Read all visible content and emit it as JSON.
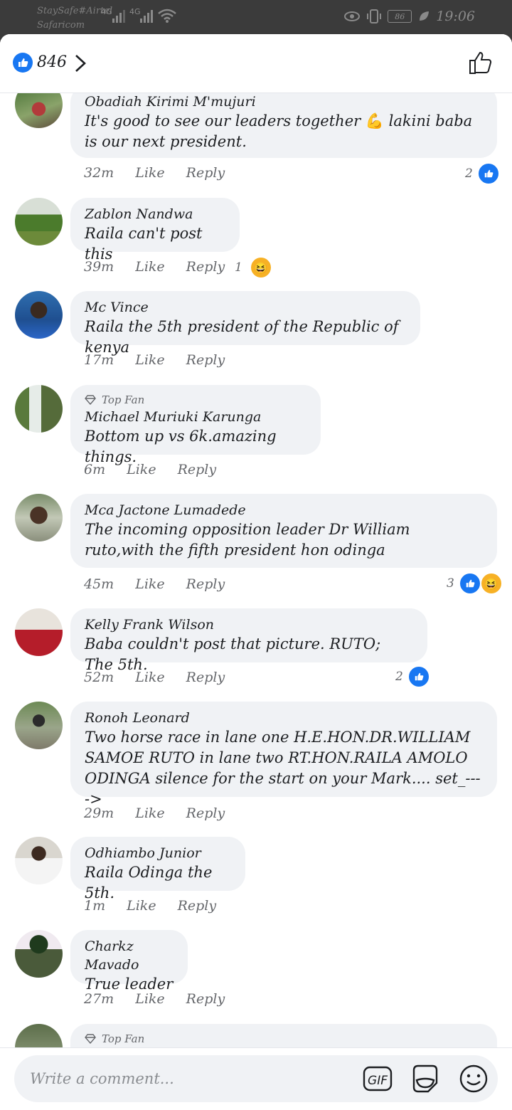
{
  "status_bar": {
    "carrier1": "StaySafe#Airtel",
    "carrier2": "Safaricom",
    "net1": "4G",
    "net2": "4G",
    "battery": "86",
    "time": "19:06"
  },
  "header": {
    "like_count": "846"
  },
  "comments": [
    {
      "author": "Obadiah Kirimi M'mujuri",
      "text_before": "It's good to see our leaders together ",
      "emoji": "💪",
      "text_after": " lakini  baba is our next president.",
      "time": "32m",
      "like": "Like",
      "reply": "Reply",
      "reaction_count": "2"
    },
    {
      "author": "Zablon Nandwa",
      "text": "Raila can't post this",
      "time": "39m",
      "like": "Like",
      "reply": "Reply",
      "reaction_count": "1"
    },
    {
      "author": "Mc Vince",
      "text": "Raila the 5th president of the Republic of kenya",
      "time": "17m",
      "like": "Like",
      "reply": "Reply"
    },
    {
      "badge": "Top Fan",
      "author": "Michael Muriuki Karunga",
      "text": "Bottom up vs 6k.amazing things.",
      "time": "6m",
      "like": "Like",
      "reply": "Reply"
    },
    {
      "author": "Mca Jactone Lumadede",
      "text": "The incoming opposition leader Dr William ruto,with the fifth president hon odinga",
      "time": "45m",
      "like": "Like",
      "reply": "Reply",
      "reaction_count": "3"
    },
    {
      "author": "Kelly Frank Wilson",
      "text": "Baba couldn't post that picture. RUTO; The 5th.",
      "time": "52m",
      "like": "Like",
      "reply": "Reply",
      "reaction_count": "2"
    },
    {
      "author": "Ronoh Leonard",
      "text": "Two horse race in lane one H.E.HON.DR.WILLIAM SAMOE RUTO in lane two RT.HON.RAILA AMOLO ODINGA silence for the start on your Mark.... set_---->",
      "time": "29m",
      "like": "Like",
      "reply": "Reply"
    },
    {
      "author": "Odhiambo Junior",
      "text": "Raila Odinga the 5th.",
      "time": "1m",
      "like": "Like",
      "reply": "Reply"
    },
    {
      "author": "Charkz Mavado",
      "text": "True leader",
      "time": "27m",
      "like": "Like",
      "reply": "Reply"
    },
    {
      "badge": "Top Fan"
    }
  ],
  "composer": {
    "placeholder": "Write a comment...",
    "gif_label": "GIF"
  },
  "colors": {
    "accent": "#1877f2",
    "bubble": "#f0f2f5",
    "haha": "#f7b125"
  }
}
